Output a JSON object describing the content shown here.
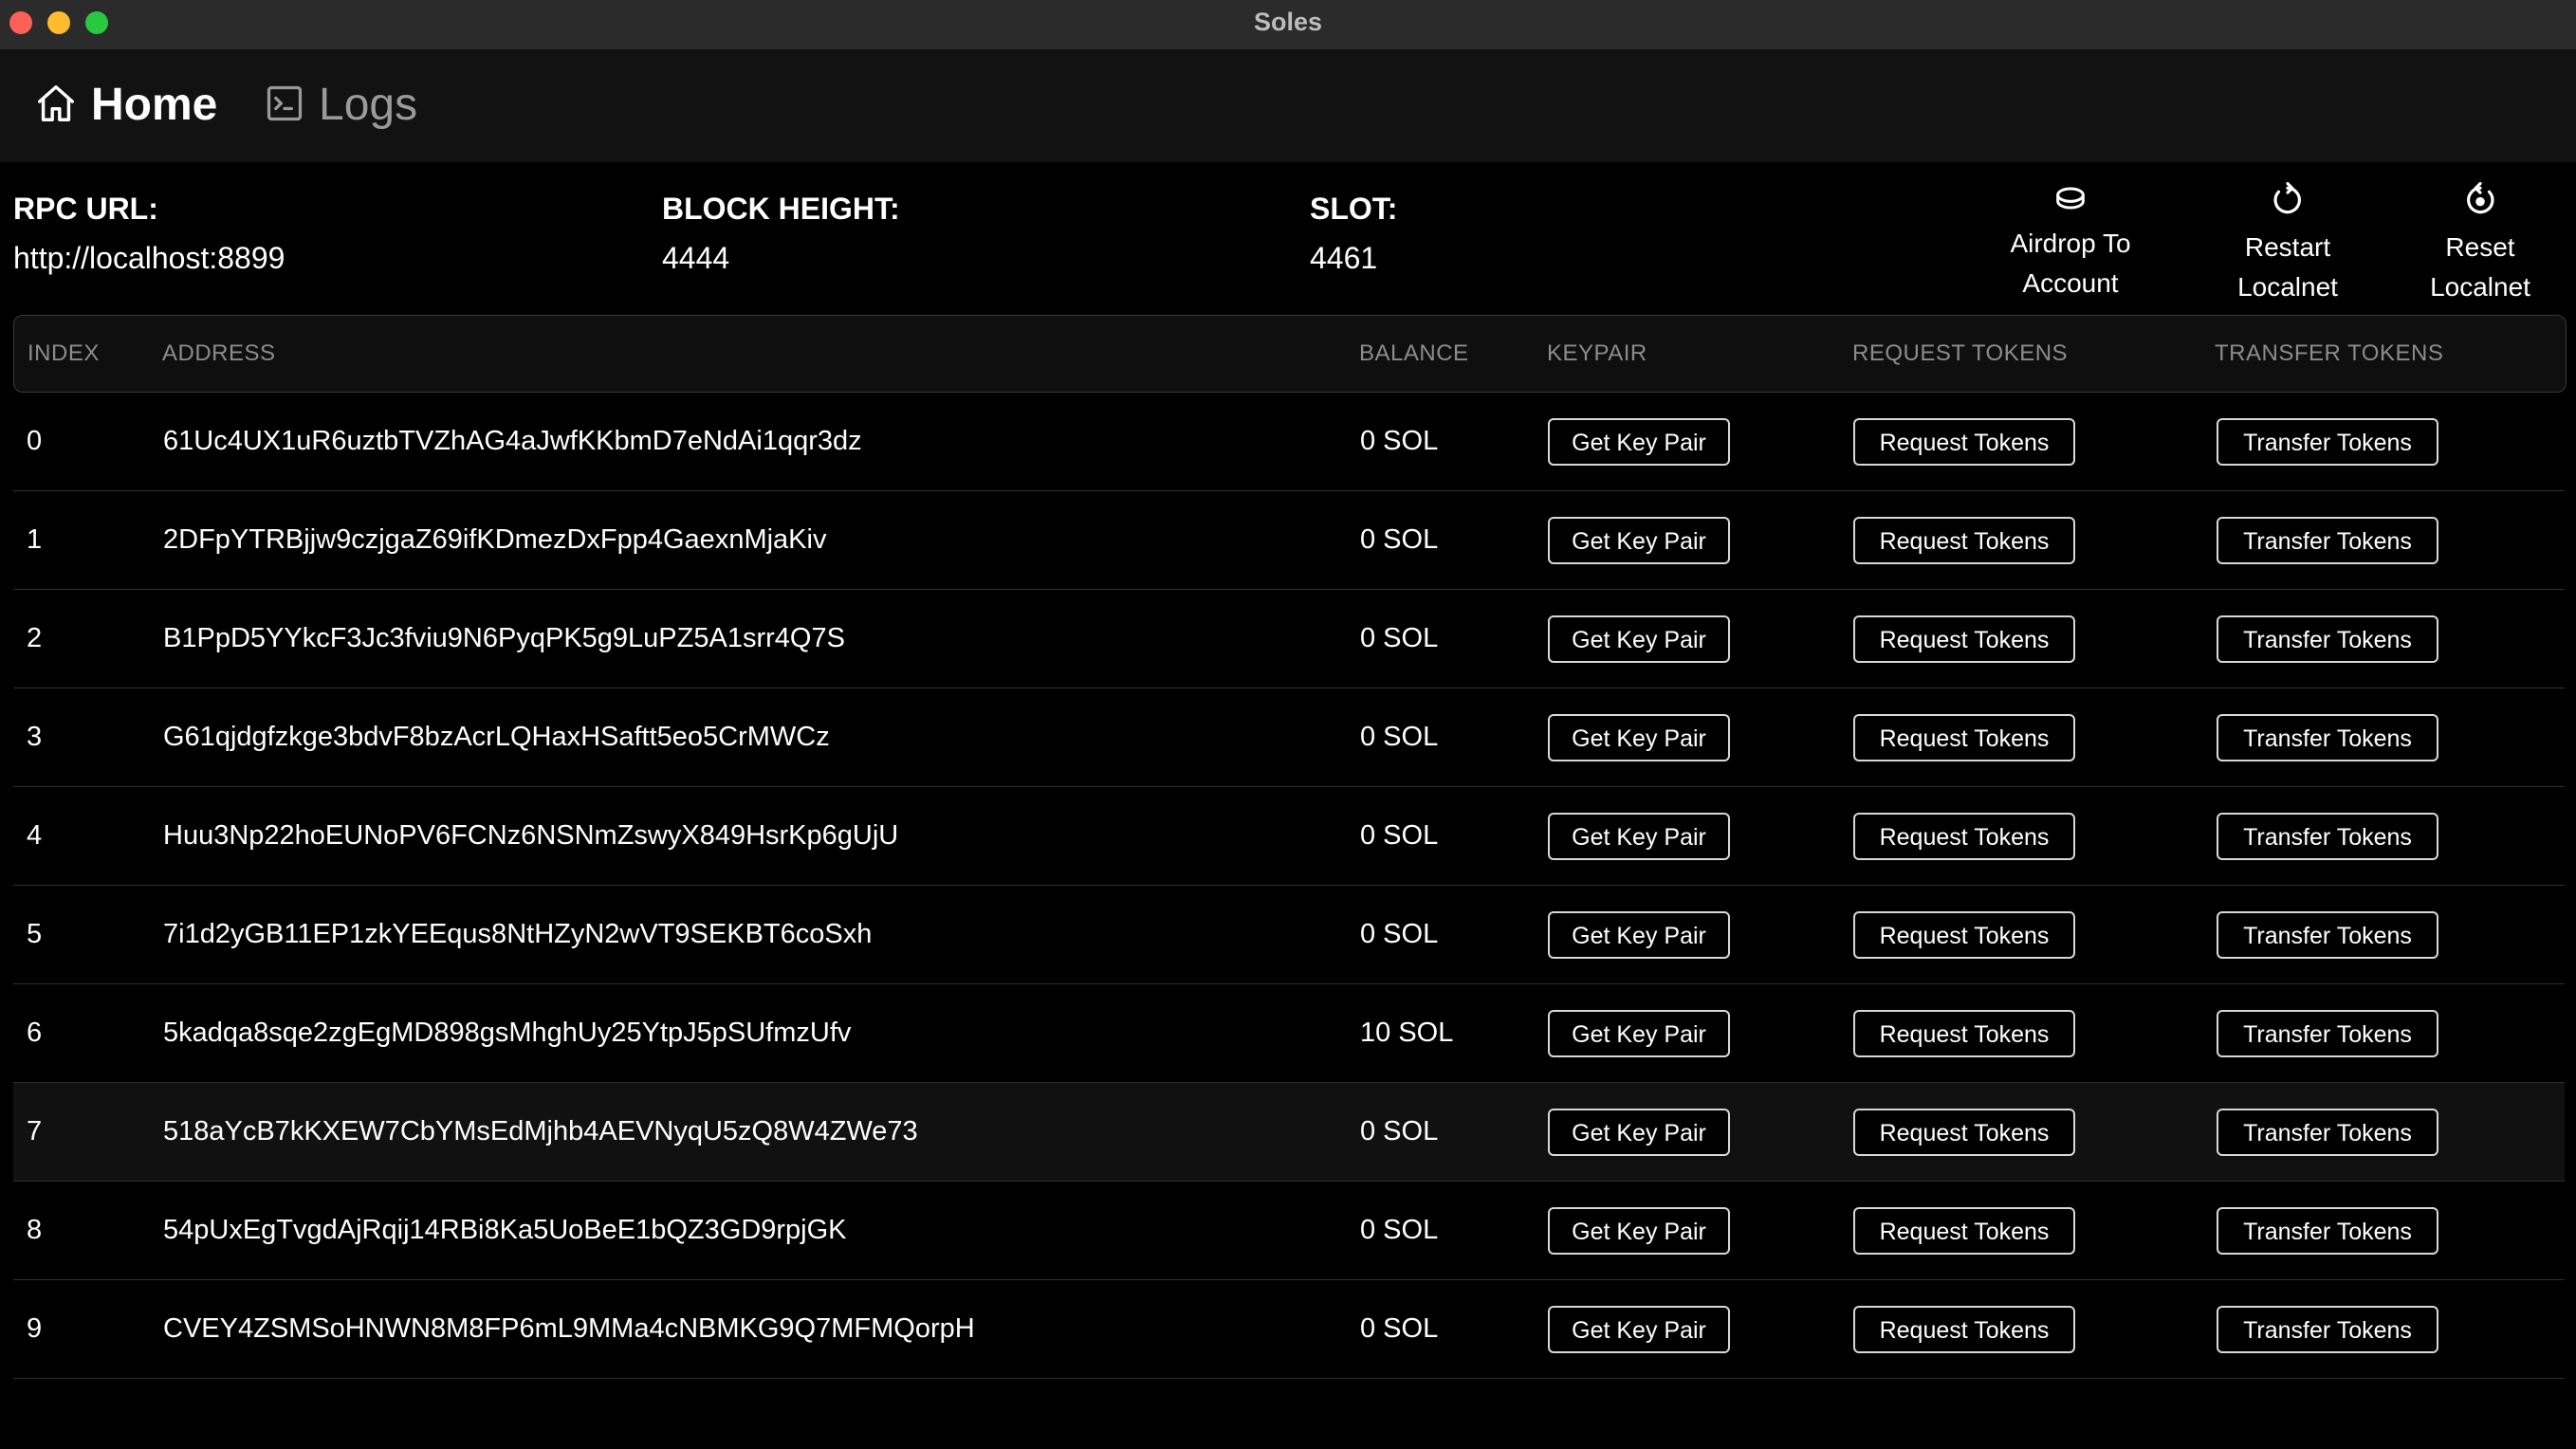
{
  "window": {
    "title": "Soles"
  },
  "nav": {
    "home_label": "Home",
    "home_icon": "home-icon",
    "logs_label": "Logs",
    "logs_icon": "terminal-icon"
  },
  "stats": {
    "rpc_label": "RPC URL:",
    "rpc_value": "http://localhost:8899",
    "block_label": "BLOCK HEIGHT:",
    "block_value": "4444",
    "slot_label": "SLOT:",
    "slot_value": "4461"
  },
  "actions": {
    "airdrop_line1": "Airdrop To",
    "airdrop_line2": "Account",
    "airdrop_icon": "coin-icon",
    "restart_line1": "Restart",
    "restart_line2": "Localnet",
    "restart_icon": "restart-icon",
    "reset_line1": "Reset",
    "reset_line2": "Localnet",
    "reset_icon": "reset-icon"
  },
  "table": {
    "headers": [
      "INDEX",
      "ADDRESS",
      "BALANCE",
      "KEYPAIR",
      "REQUEST TOKENS",
      "TRANSFER TOKENS"
    ],
    "button_labels": {
      "keypair": "Get Key Pair",
      "request": "Request Tokens",
      "transfer": "Transfer Tokens"
    },
    "rows": [
      {
        "index": "0",
        "address": "61Uc4UX1uR6uztbTVZhAG4aJwfKKbmD7eNdAi1qqr3dz",
        "balance": "0 SOL"
      },
      {
        "index": "1",
        "address": "2DFpYTRBjjw9czjgaZ69ifKDmezDxFpp4GaexnMjaKiv",
        "balance": "0 SOL"
      },
      {
        "index": "2",
        "address": "B1PpD5YYkcF3Jc3fviu9N6PyqPK5g9LuPZ5A1srr4Q7S",
        "balance": "0 SOL"
      },
      {
        "index": "3",
        "address": "G61qjdgfzkge3bdvF8bzAcrLQHaxHSaftt5eo5CrMWCz",
        "balance": "0 SOL"
      },
      {
        "index": "4",
        "address": "Huu3Np22hoEUNoPV6FCNz6NSNmZswyX849HsrKp6gUjU",
        "balance": "0 SOL"
      },
      {
        "index": "5",
        "address": "7i1d2yGB11EP1zkYEEqus8NtHZyN2wVT9SEKBT6coSxh",
        "balance": "0 SOL"
      },
      {
        "index": "6",
        "address": "5kadqa8sqe2zgEgMD898gsMhghUy25YtpJ5pSUfmzUfv",
        "balance": "10 SOL"
      },
      {
        "index": "7",
        "address": "518aYcB7kKXEW7CbYMsEdMjhb4AEVNyqU5zQ8W4ZWe73",
        "balance": "0 SOL"
      },
      {
        "index": "8",
        "address": "54pUxEgTvgdAjRqij14RBi8Ka5UoBeE1bQZ3GD9rpjGK",
        "balance": "0 SOL"
      },
      {
        "index": "9",
        "address": "CVEY4ZSMSoHNWN8M8FP6mL9MMa4cNBMKG9Q7MFMQorpH",
        "balance": "0 SOL"
      }
    ]
  }
}
